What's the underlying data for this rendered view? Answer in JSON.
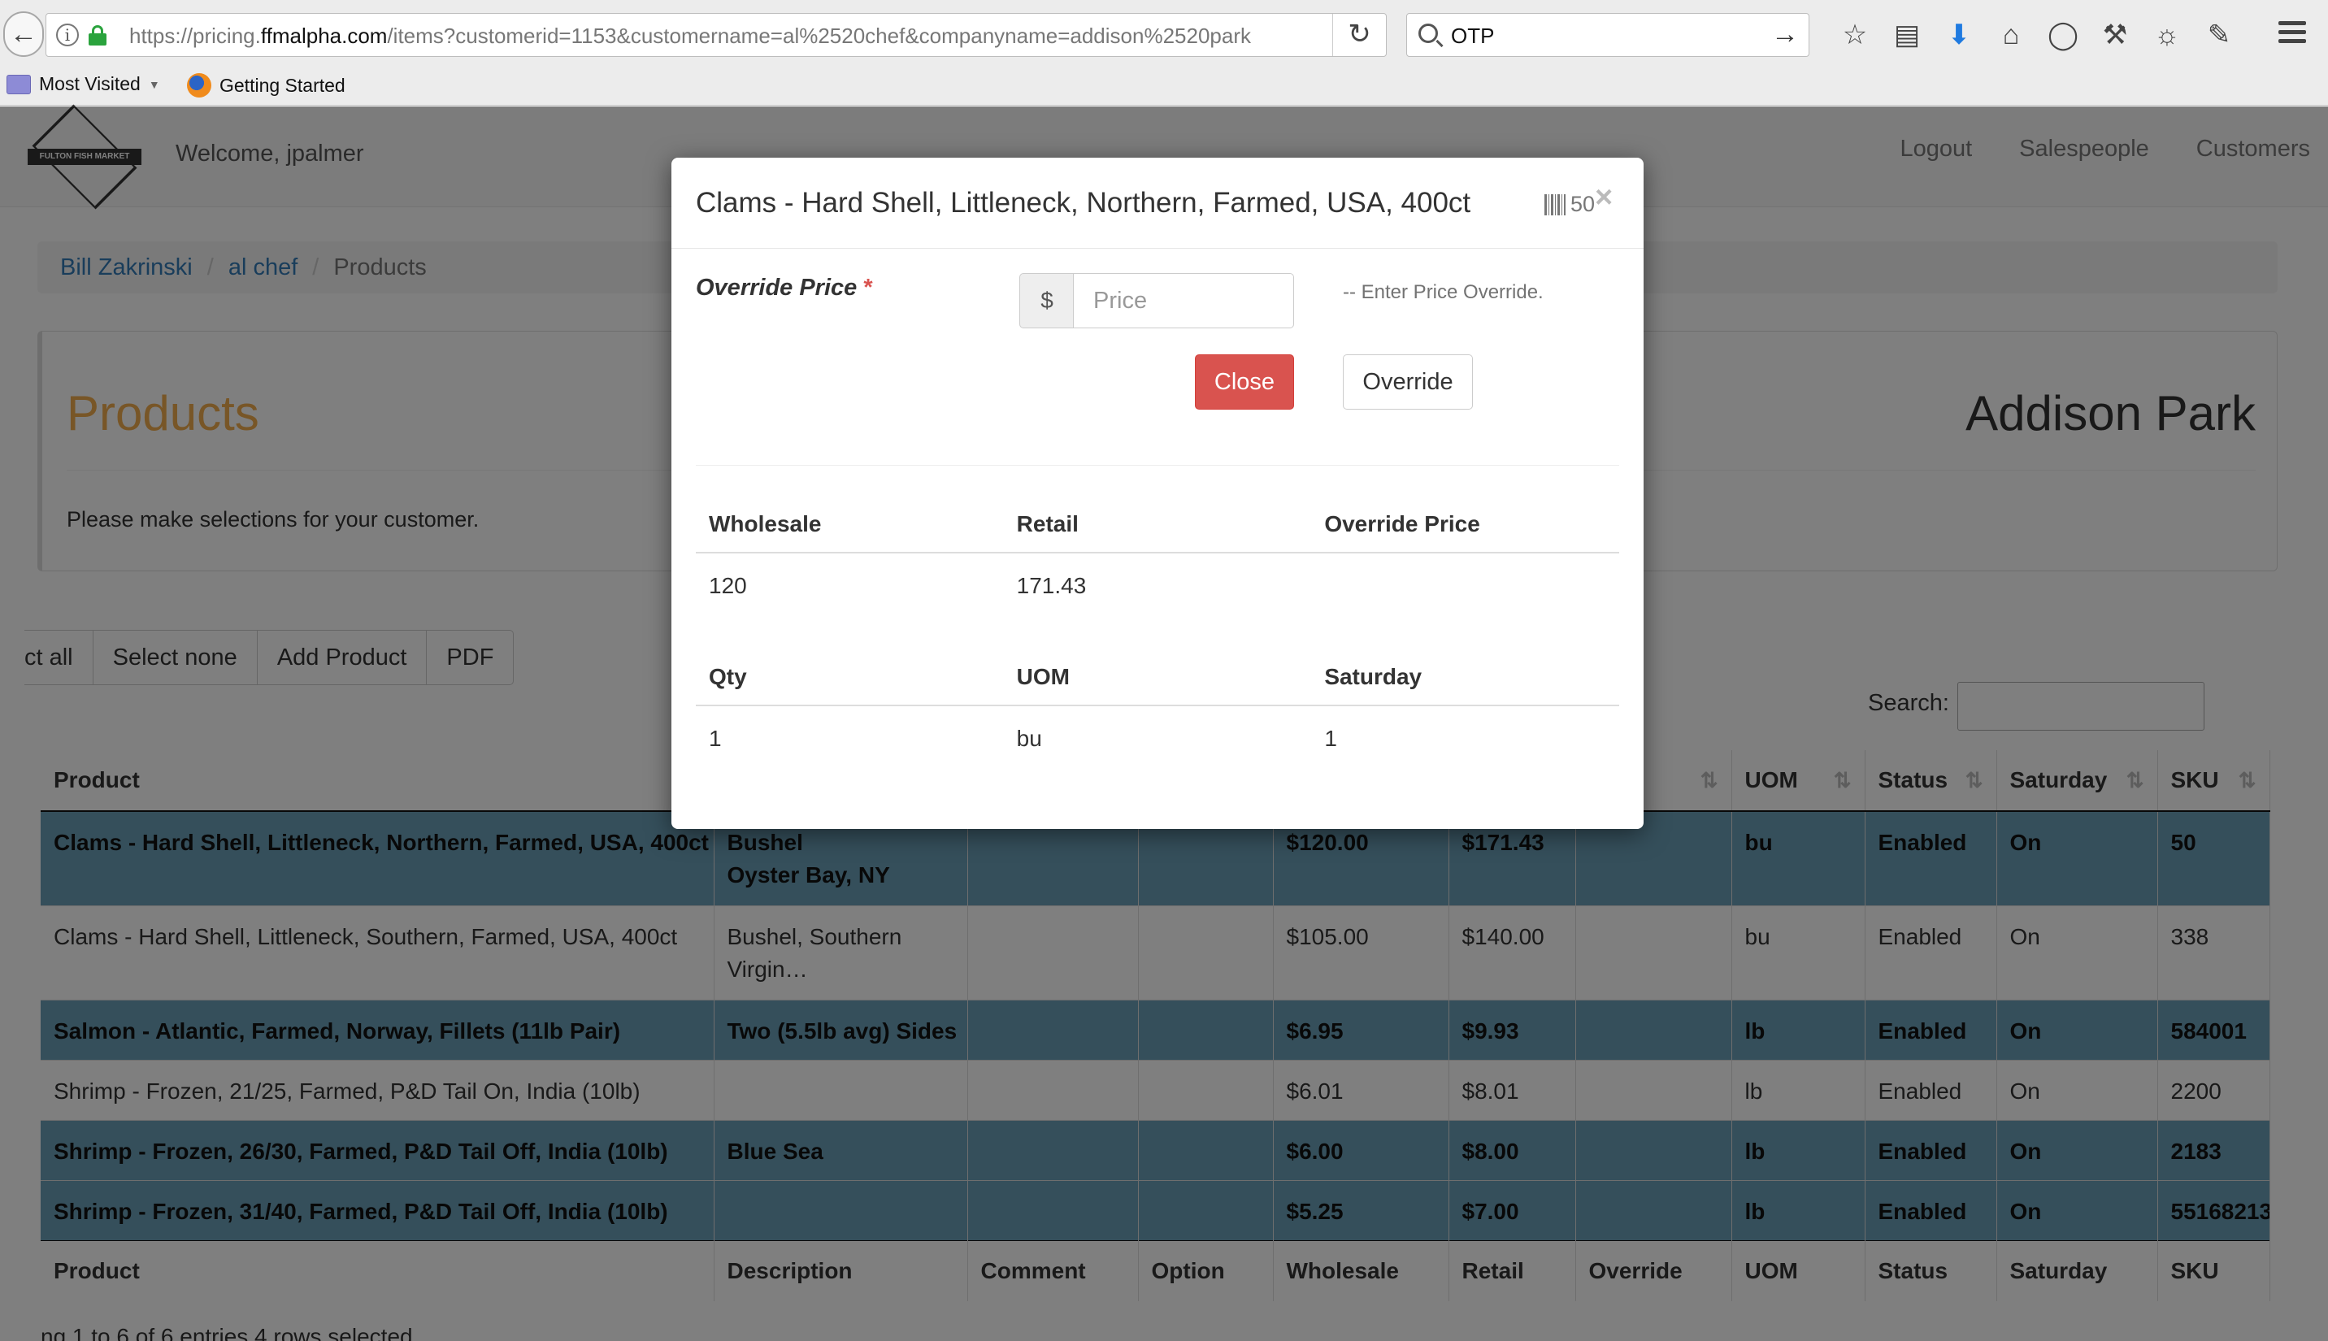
{
  "browser": {
    "url_prefix": "https://pricing.",
    "url_host": "ffmalpha.com",
    "url_rest": "/items?customerid=1153&customername=al%2520chef&companyname=addison%2520park",
    "search_query": "OTP",
    "bookmarks": [
      {
        "label": "Most Visited"
      },
      {
        "label": "Getting Started"
      }
    ]
  },
  "navbar": {
    "logo_text": "FULTON FISH MARKET",
    "welcome": "Welcome, jpalmer",
    "links": [
      "Logout",
      "Salespeople",
      "Customers"
    ]
  },
  "breadcrumb": {
    "items": [
      "Bill Zakrinski",
      "al chef",
      "Products"
    ]
  },
  "panel": {
    "title": "Products",
    "company": "Addison Park",
    "lead": "Please make selections for your customer."
  },
  "toolbar": {
    "select_all": "ct all",
    "select_none": "Select none",
    "add_product": "Add Product",
    "pdf": "PDF",
    "search_label": "Search:"
  },
  "table": {
    "headers": [
      "Product",
      "",
      "",
      "",
      "",
      "",
      "ide",
      "UOM",
      "Status",
      "Saturday",
      "SKU"
    ],
    "footers": [
      "Product",
      "Description",
      "Comment",
      "Option",
      "Wholesale",
      "Retail",
      "Override",
      "UOM",
      "Status",
      "Saturday",
      "SKU"
    ],
    "rows": [
      {
        "selected": true,
        "product": "Clams - Hard Shell, Littleneck, Northern, Farmed, USA, 400ct",
        "description_1": "Bushel",
        "description_2": "Oyster Bay, NY",
        "comment": "",
        "option": "",
        "wholesale": "$120.00",
        "retail": "$171.43",
        "override": "",
        "uom": "bu",
        "status": "Enabled",
        "saturday": "On",
        "sku": "50"
      },
      {
        "selected": false,
        "product": "Clams - Hard Shell, Littleneck, Southern, Farmed, USA, 400ct",
        "description_1": "Bushel, Southern",
        "description_2": "Virgin…",
        "comment": "",
        "option": "",
        "wholesale": "$105.00",
        "retail": "$140.00",
        "override": "",
        "uom": "bu",
        "status": "Enabled",
        "saturday": "On",
        "sku": "338"
      },
      {
        "selected": true,
        "product": "Salmon - Atlantic, Farmed, Norway, Fillets (11lb Pair)",
        "description_1": "Two (5.5lb avg) Sides",
        "description_2": "",
        "comment": "",
        "option": "",
        "wholesale": "$6.95",
        "retail": "$9.93",
        "override": "",
        "uom": "lb",
        "status": "Enabled",
        "saturday": "On",
        "sku": "584001"
      },
      {
        "selected": false,
        "product": "Shrimp - Frozen, 21/25, Farmed, P&D Tail On, India (10lb)",
        "description_1": "",
        "description_2": "",
        "comment": "",
        "option": "",
        "wholesale": "$6.01",
        "retail": "$8.01",
        "override": "",
        "uom": "lb",
        "status": "Enabled",
        "saturday": "On",
        "sku": "2200"
      },
      {
        "selected": true,
        "product": "Shrimp - Frozen, 26/30, Farmed, P&D Tail Off, India (10lb)",
        "description_1": "Blue Sea",
        "description_2": "",
        "comment": "",
        "option": "",
        "wholesale": "$6.00",
        "retail": "$8.00",
        "override": "",
        "uom": "lb",
        "status": "Enabled",
        "saturday": "On",
        "sku": "2183"
      },
      {
        "selected": true,
        "product": "Shrimp - Frozen, 31/40, Farmed, P&D Tail Off, India (10lb)",
        "description_1": "",
        "description_2": "",
        "comment": "",
        "option": "",
        "wholesale": "$5.25",
        "retail": "$7.00",
        "override": "",
        "uom": "lb",
        "status": "Enabled",
        "saturday": "On",
        "sku": "55168213"
      }
    ],
    "info": "ng 1 to 6 of 6 entries    4 rows selected"
  },
  "modal": {
    "title": "Clams - Hard Shell, Littleneck, Northern, Farmed, USA, 400ct",
    "sku": "50",
    "close_x": "×",
    "override_label": "Override Price",
    "required_mark": "*",
    "currency": "$",
    "price_placeholder": "Price",
    "help": "-- Enter Price Override.",
    "close_button": "Close",
    "override_button": "Override",
    "table1": {
      "headers": [
        "Wholesale",
        "Retail",
        "Override Price"
      ],
      "values": [
        "120",
        "171.43",
        ""
      ]
    },
    "table2": {
      "headers": [
        "Qty",
        "UOM",
        "Saturday"
      ],
      "values": [
        "1",
        "bu",
        "1"
      ]
    }
  }
}
